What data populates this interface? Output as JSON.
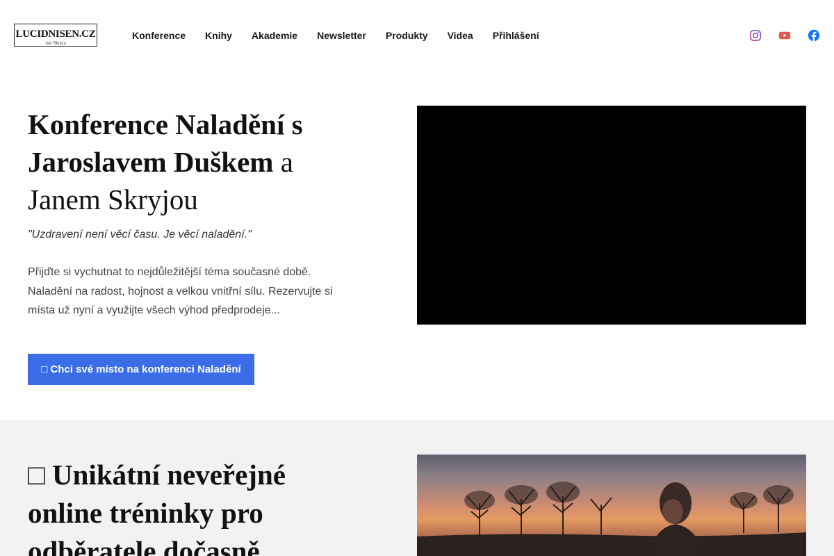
{
  "header": {
    "logo_main": "LUCIDNISEN.CZ",
    "logo_sub": "Jan Skryja",
    "nav": [
      "Konference",
      "Knihy",
      "Akademie",
      "Newsletter",
      "Produkty",
      "Videa",
      "Přihlášení"
    ],
    "social": [
      {
        "icon": "instagram-icon",
        "color": "#7b3fa6"
      },
      {
        "icon": "youtube-icon",
        "color": "#e2574c"
      },
      {
        "icon": "facebook-icon",
        "color": "#1877f2"
      }
    ]
  },
  "hero": {
    "title_bold": "Konference Naladění s Jaroslavem Duškem",
    "title_light": " a Janem Skryjou",
    "quote": "\"Uzdravení není věcí času. Je věcí naladění.\"",
    "description": "Přijďte si vychutnat to nejdůležitější téma současné době. Naladění na radost, hojnost a velkou vnitřní sílu. Rezervujte si místa už nyní a využijte všech výhod předprodeje...",
    "cta_icon": "□",
    "cta_label": "Chci své místo na konferenci Naladění",
    "accent": "#3b6ee6"
  },
  "section2": {
    "title_icon": "□",
    "title_bold": "Unikátní neveřejné online tréninky",
    "title_light": " pro odběratele dočasně",
    "background": "#f1f2f1"
  }
}
